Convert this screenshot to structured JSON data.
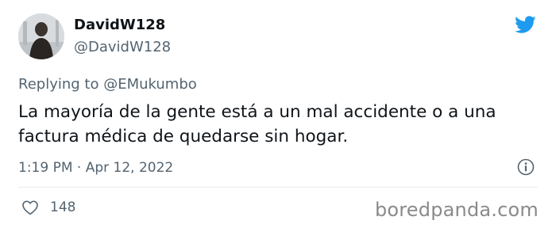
{
  "user": {
    "display_name": "DavidW128",
    "handle": "@DavidW128"
  },
  "reply": {
    "prefix": "Replying to",
    "mention": "@EMukumbo"
  },
  "tweet": {
    "text": "La mayoría de la gente está a un mal accidente o a una factura médica de quedarse sin hogar.",
    "timestamp": "1:19 PM · Apr 12, 2022",
    "likes": "148"
  },
  "icons": {
    "brand": "twitter-bird-icon",
    "info": "info-icon",
    "like": "heart-icon"
  },
  "colors": {
    "twitter_blue": "#1d9bf0",
    "secondary_text": "#536471",
    "primary_text": "#0f1419"
  },
  "watermark": "boredpanda.com"
}
